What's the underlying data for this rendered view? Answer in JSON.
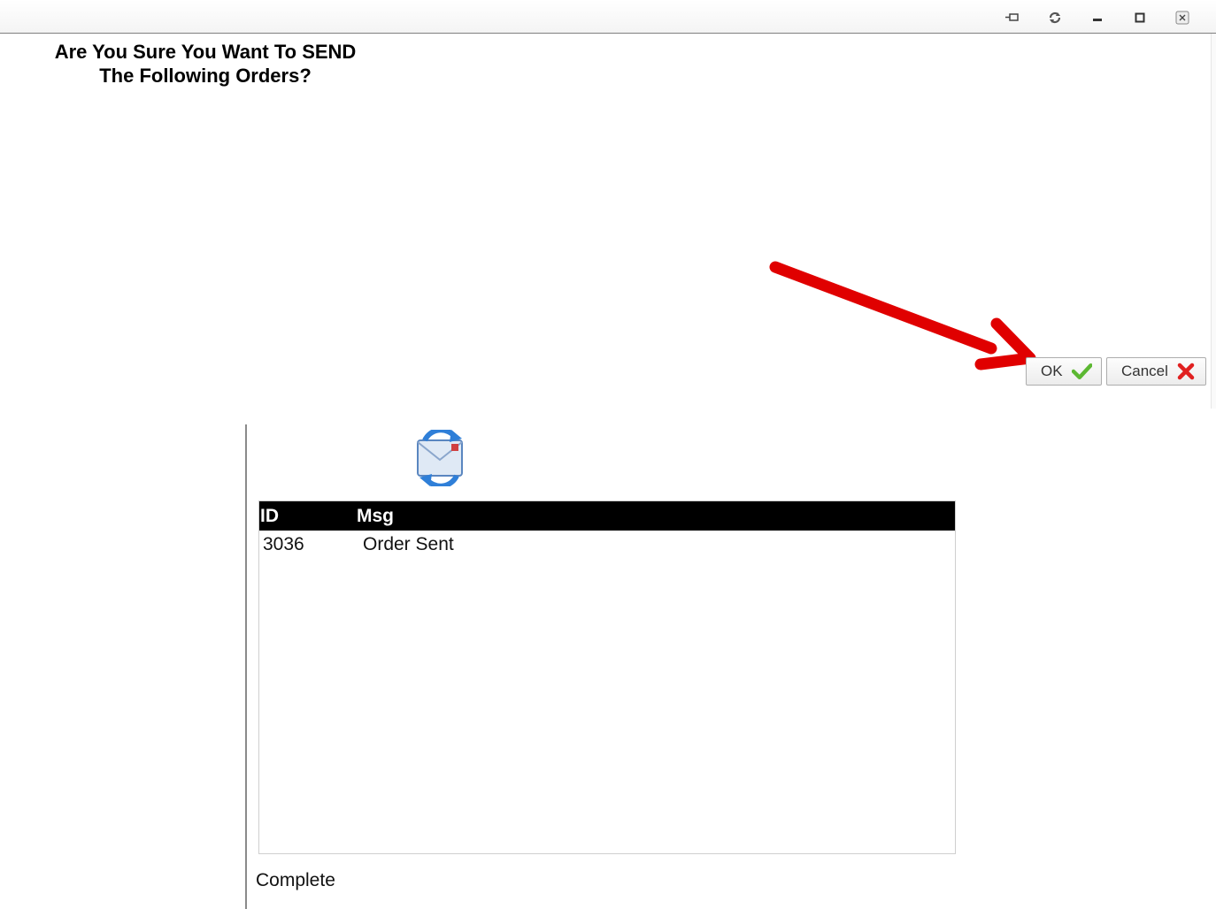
{
  "window": {
    "controls": [
      "pin-icon",
      "refresh-icon",
      "minimize-icon",
      "maximize-icon",
      "close-icon"
    ]
  },
  "dialog": {
    "question_line1": "Are You Sure You Want To SEND",
    "question_line2": "The Following Orders?",
    "ok_label": "OK",
    "cancel_label": "Cancel",
    "ok_icon": "checkmark-icon",
    "cancel_icon": "x-icon",
    "annotation": "red-arrow-pointing-to-ok"
  },
  "results": {
    "icon": "send-receive-mail-icon",
    "columns": [
      "ID",
      "Msg"
    ],
    "rows": [
      {
        "id": "3036",
        "msg": "Order Sent"
      }
    ],
    "status": "Complete"
  },
  "colors": {
    "header_bg": "#000000",
    "arrow": "#e00000",
    "check": "#5cb832",
    "cross": "#e02020"
  }
}
